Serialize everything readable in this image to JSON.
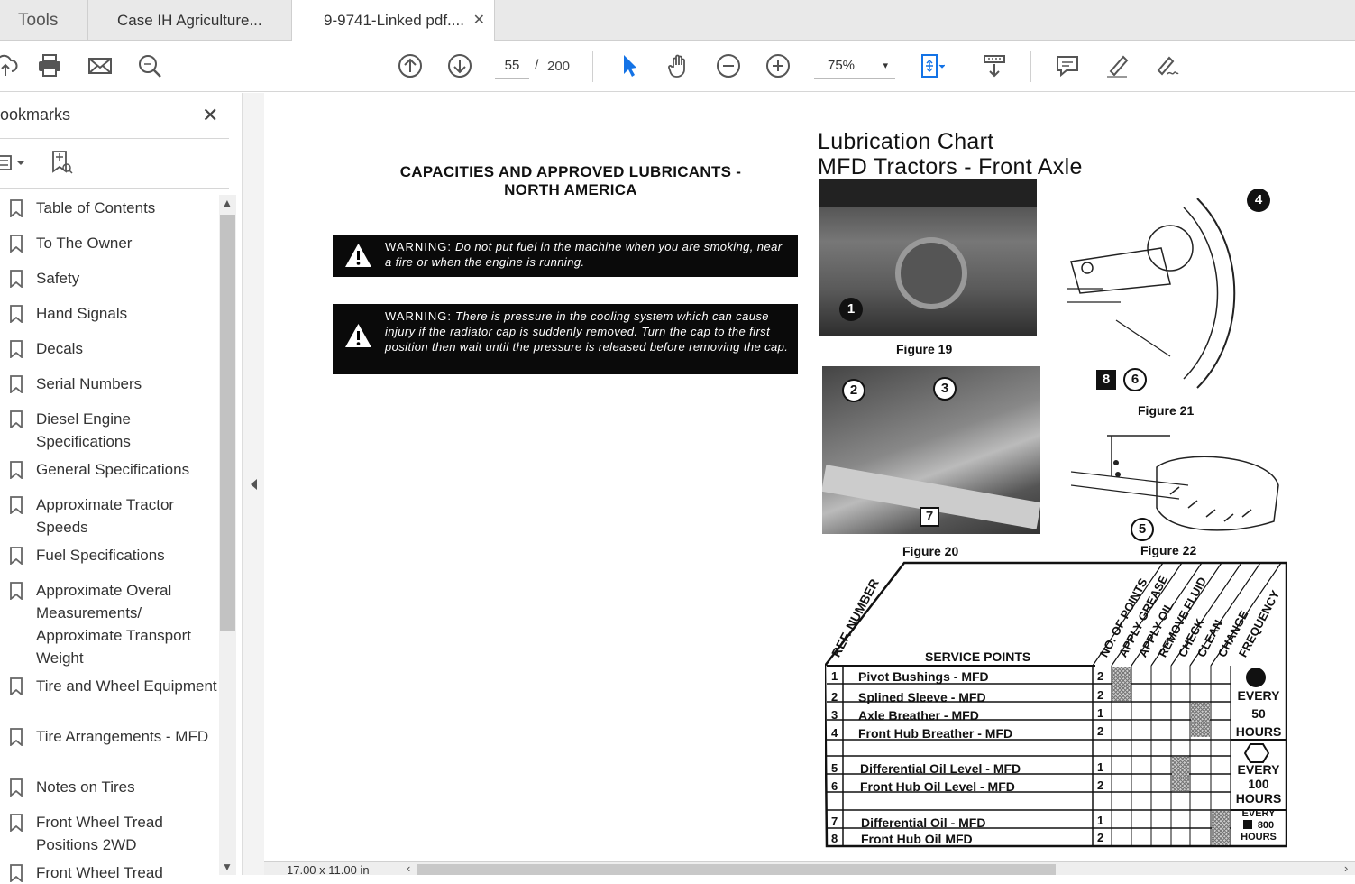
{
  "tabs": {
    "tools": "Tools",
    "tab1": "Case IH Agriculture...",
    "tab2": "9-9741-Linked pdf....",
    "close": "✕"
  },
  "toolbar": {
    "page_current": "55",
    "page_separator": "/",
    "page_total": "200",
    "zoom": "75%",
    "zoom_caret": "▾"
  },
  "sidebar": {
    "title": "ookmarks",
    "close": "✕",
    "items": [
      {
        "label": "Table of Contents"
      },
      {
        "label": "To The Owner"
      },
      {
        "label": "Safety"
      },
      {
        "label": "Hand Signals"
      },
      {
        "label": "Decals"
      },
      {
        "label": "Serial Numbers"
      },
      {
        "label": "Diesel Engine Specifications"
      },
      {
        "label": "General Specifications"
      },
      {
        "label": "Approximate Tractor Speeds"
      },
      {
        "label": "Fuel Specifications"
      },
      {
        "label": "Approximate Overal Measurements/ Approximate Transport Weight"
      },
      {
        "label": "Tire and Wheel Equipment"
      },
      {
        "label": "Tire Arrangements - MFD"
      },
      {
        "label": "Notes on Tires"
      },
      {
        "label": "Front Wheel Tread Positions 2WD"
      },
      {
        "label": "Front Wheel Tread"
      }
    ]
  },
  "status": {
    "page_size": "17.00 x 11.00 in"
  },
  "document": {
    "heading_line1": "CAPACITIES AND APPROVED LUBRICANTS -",
    "heading_line2": "NORTH AMERICA",
    "warning1_label": "WARNING:",
    "warning1_text": "Do not put fuel in the machine when you are smoking, near a fire or when the engine is running.",
    "warning2_label": "WARNING:",
    "warning2_text": "There is pressure in the cooling system which can cause injury if the radiator cap is suddenly removed. Turn the cap to the first position then wait until the pressure is released before removing the cap.",
    "chart_title_line1": "Lubrication Chart",
    "chart_title_line2": "MFD Tractors - Front Axle",
    "figure19": "Figure 19",
    "figure20": "Figure 20",
    "figure21": "Figure 21",
    "figure22": "Figure 22",
    "callouts": [
      "1",
      "2",
      "3",
      "4",
      "5",
      "6",
      "7",
      "8"
    ],
    "table": {
      "ref_header": "REF. NUMBER",
      "service_header": "SERVICE POINTS",
      "col_headers": [
        "NO. OF POINTS",
        "APPLY GREASE",
        "APPLY OIL",
        "REMOVE FLUID",
        "CHECK",
        "CLEAN",
        "CHANGE",
        "FREQUENCY"
      ],
      "rows": [
        {
          "ref": "1",
          "name": "Pivot Bushings - MFD",
          "count": "2"
        },
        {
          "ref": "2",
          "name": "Splined Sleeve - MFD",
          "count": "2"
        },
        {
          "ref": "3",
          "name": "Axle Breather - MFD",
          "count": "1"
        },
        {
          "ref": "4",
          "name": "Front Hub Breather - MFD",
          "count": "2"
        },
        {
          "ref": "5",
          "name": "Differential Oil Level - MFD",
          "count": "1"
        },
        {
          "ref": "6",
          "name": "Front Hub Oil Level - MFD",
          "count": "2"
        },
        {
          "ref": "7",
          "name": "Differential Oil - MFD",
          "count": "1"
        },
        {
          "ref": "8",
          "name": "Front Hub Oil MFD",
          "count": "2"
        }
      ],
      "freq1": "EVERY 50 HOURS",
      "freq2": "EVERY 100 HOURS",
      "freq3_a": "EVERY",
      "freq3_b": "800",
      "freq3_c": "HOURS"
    }
  }
}
